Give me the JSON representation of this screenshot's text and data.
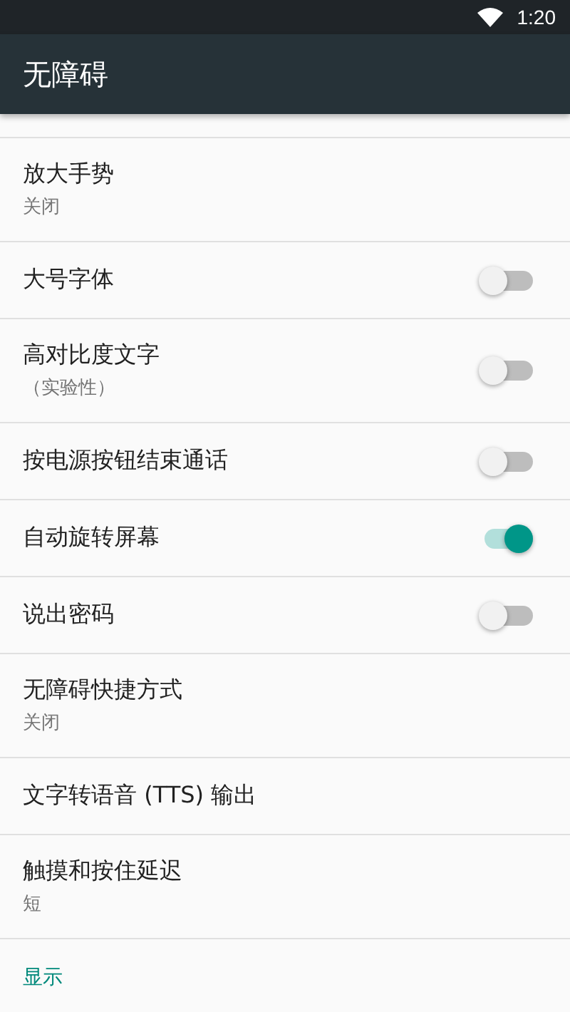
{
  "status_bar": {
    "time": "1:20"
  },
  "toolbar": {
    "title": "无障碍"
  },
  "items": [
    {
      "kind": "text",
      "title": "放大手势",
      "summary": "关闭"
    },
    {
      "kind": "switch",
      "title": "大号字体",
      "on": false
    },
    {
      "kind": "switch",
      "title": "高对比度文字",
      "summary": "（实验性）",
      "on": false
    },
    {
      "kind": "switch",
      "title": "按电源按钮结束通话",
      "on": false
    },
    {
      "kind": "switch",
      "title": "自动旋转屏幕",
      "on": true
    },
    {
      "kind": "switch",
      "title": "说出密码",
      "on": false
    },
    {
      "kind": "text",
      "title": "无障碍快捷方式",
      "summary": "关闭"
    },
    {
      "kind": "text",
      "title": "文字转语音 (TTS) 输出"
    },
    {
      "kind": "text",
      "title": "触摸和按住延迟",
      "summary": "短"
    }
  ],
  "section_header": "显示"
}
